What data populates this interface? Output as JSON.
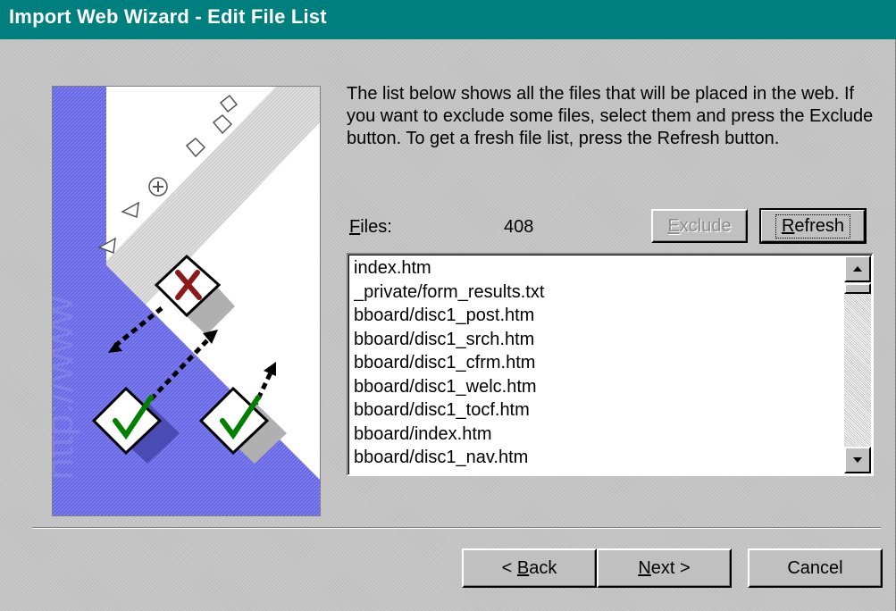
{
  "window": {
    "title": "Import Web Wizard - Edit File List"
  },
  "intro_text": "The list below shows all the files that will be placed in the web. If you want to exclude some files, select them and press the Exclude button. To get a fresh file list, press the Refresh button.",
  "files": {
    "label_accel": "F",
    "label_rest": "iles:",
    "count": "408",
    "items": [
      "index.htm",
      "_private/form_results.txt",
      "bboard/disc1_post.htm",
      "bboard/disc1_srch.htm",
      "bboard/disc1_cfrm.htm",
      "bboard/disc1_welc.htm",
      "bboard/disc1_tocf.htm",
      "bboard/index.htm",
      "bboard/disc1_nav.htm"
    ]
  },
  "buttons": {
    "exclude": {
      "accel": "E",
      "rest": "xclude",
      "enabled": false
    },
    "refresh": {
      "accel": "R",
      "rest": "efresh",
      "enabled": true
    },
    "back": {
      "prefix": "< ",
      "accel": "B",
      "rest": "ack"
    },
    "next": {
      "accel": "N",
      "rest": "ext >"
    },
    "cancel": {
      "label": "Cancel"
    }
  },
  "illustration": {
    "watermark_text": "http://www",
    "colors": {
      "blue": "#6464e6",
      "gray": "#c8c8c8",
      "check": "#008000",
      "cross": "#8b1a1a"
    }
  },
  "icons": {
    "scroll_up": "scroll-up-arrow-icon",
    "scroll_down": "scroll-down-arrow-icon"
  }
}
